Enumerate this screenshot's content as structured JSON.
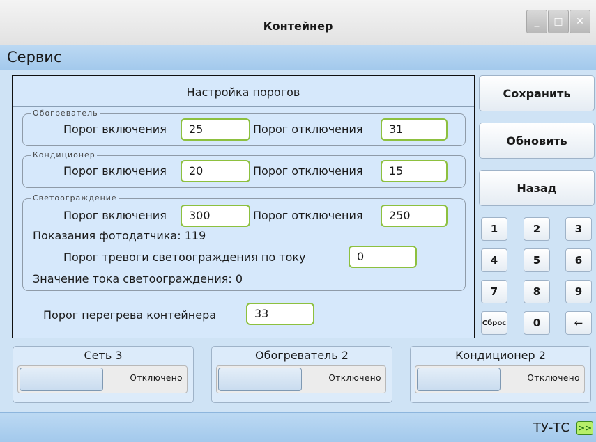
{
  "window": {
    "title": "Контейнер",
    "minimize": "_",
    "maximize": "□",
    "close": "✕"
  },
  "menu": {
    "service": "Сервис"
  },
  "thresholds": {
    "title": "Настройка порогов",
    "heater": {
      "label": "Обогреватель",
      "on_label": "Порог включения",
      "on_value": "25",
      "off_label": "Порог отключения",
      "off_value": "31"
    },
    "conditioner": {
      "label": "Кондиционер",
      "on_label": "Порог включения",
      "on_value": "20",
      "off_label": "Порог отключения",
      "off_value": "15"
    },
    "lighting": {
      "label": "Светоограждение",
      "on_label": "Порог включения",
      "on_value": "300",
      "off_label": "Порог отключения",
      "off_value": "250",
      "photo_reading": "Показания фотодатчика: 119",
      "alarm_label": "Порог тревоги светоограждения по току",
      "alarm_value": "0",
      "current_value": "Значение тока светоограждения: 0"
    },
    "overheat_label": "Порог перегрева контейнера",
    "overheat_value": "33"
  },
  "actions": {
    "save": "Сохранить",
    "refresh": "Обновить",
    "back": "Назад"
  },
  "keypad": {
    "k1": "1",
    "k2": "2",
    "k3": "3",
    "k4": "4",
    "k5": "5",
    "k6": "6",
    "k7": "7",
    "k8": "8",
    "k9": "9",
    "reset": "Сброс",
    "k0": "0",
    "backspace": "←"
  },
  "status": [
    {
      "label": "Сеть 3",
      "state": "Отключено"
    },
    {
      "label": "Обогреватель 2",
      "state": "Отключено"
    },
    {
      "label": "Кондиционер 2",
      "state": "Отключено"
    }
  ],
  "footer": {
    "tu_tc": "ТУ-ТС",
    "arrow": ">>"
  }
}
